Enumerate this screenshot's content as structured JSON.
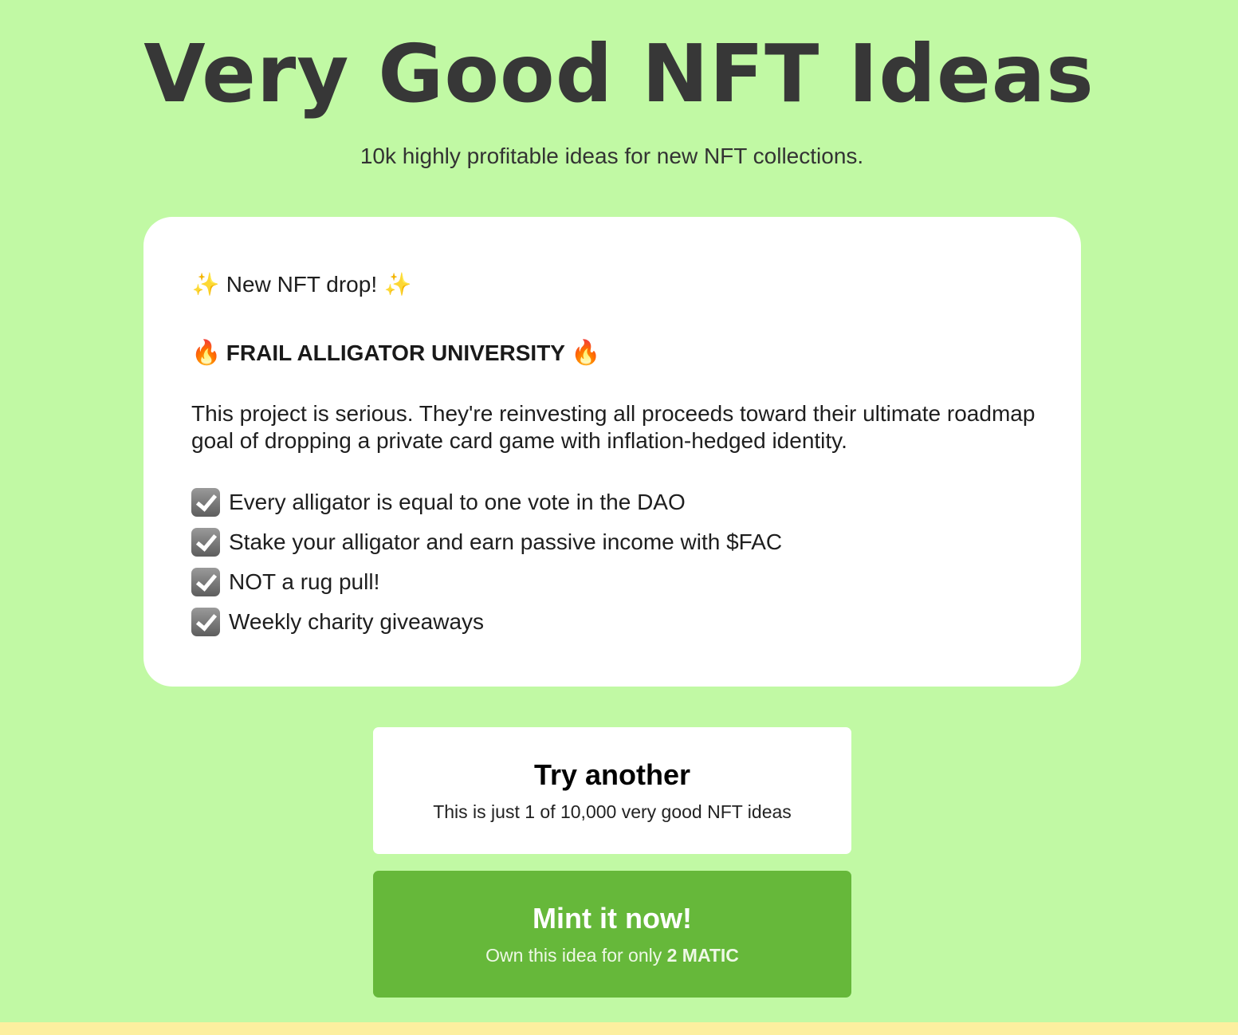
{
  "header": {
    "title": "Very Good NFT Ideas",
    "subtitle": "10k highly profitable ideas for new NFT collections."
  },
  "idea": {
    "drop_label": "New NFT drop!",
    "drop_icon": "sparkles-icon",
    "name": "FRAIL ALLIGATOR UNIVERSITY",
    "name_icon": "fire-icon",
    "description": "This project is serious. They're reinvesting all proceeds toward their ultimate roadmap goal of dropping a private card game with inflation-hedged identity.",
    "features": [
      "Every alligator is equal to one vote in the DAO",
      "Stake your alligator and earn passive income with $FAC",
      "NOT a rug pull!",
      "Weekly charity giveaways"
    ],
    "feature_icon": "checkbox-checked-icon"
  },
  "actions": {
    "try_another": {
      "label": "Try another",
      "sublabel": "This is just 1 of 10,000 very good NFT ideas"
    },
    "mint": {
      "label": "Mint it now!",
      "sublabel_prefix": "Own this idea for only",
      "price": "2 MATIC"
    }
  },
  "colors": {
    "background": "#c1f9a4",
    "card": "#ffffff",
    "mint_button": "#66b83a",
    "footer_bar": "#fcef9f"
  }
}
